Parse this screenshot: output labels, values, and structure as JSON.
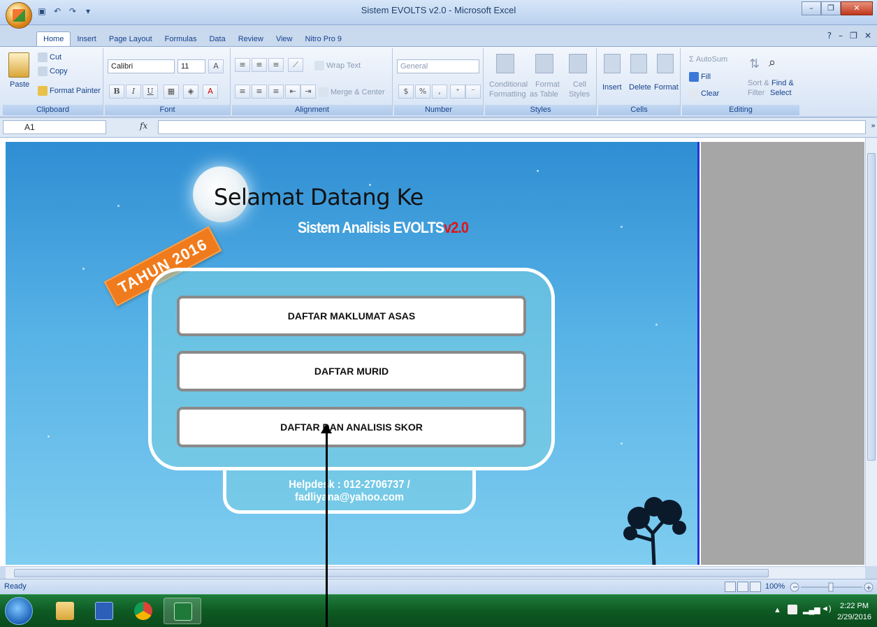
{
  "window": {
    "title": "Sistem EVOLTS v2.0 - Microsoft Excel"
  },
  "tabs": [
    "Home",
    "Insert",
    "Page Layout",
    "Formulas",
    "Data",
    "Review",
    "View",
    "Nitro Pro 9"
  ],
  "ribbon": {
    "clipboard": {
      "label": "Clipboard",
      "paste": "Paste",
      "cut": "Cut",
      "copy": "Copy",
      "format_painter": "Format Painter"
    },
    "font": {
      "label": "Font",
      "name": "Calibri",
      "size": "11"
    },
    "alignment": {
      "label": "Alignment",
      "wrap": "Wrap Text",
      "merge": "Merge & Center"
    },
    "number": {
      "label": "Number",
      "format": "General",
      "currency": "$",
      "percent": "%",
      "comma": ","
    },
    "styles": {
      "label": "Styles",
      "conditional": "Conditional",
      "conditional2": "Formatting",
      "format_table": "Format",
      "format_table2": "as Table",
      "cell_styles": "Cell",
      "cell_styles2": "Styles"
    },
    "cells": {
      "label": "Cells",
      "insert": "Insert",
      "delete": "Delete",
      "format": "Format"
    },
    "editing": {
      "label": "Editing",
      "autosum": "AutoSum",
      "fill": "Fill",
      "clear": "Clear",
      "sort": "Sort &",
      "sort2": "Filter",
      "find": "Find &",
      "find2": "Select"
    }
  },
  "formula_bar": {
    "name_box": "A1",
    "fx": "fx",
    "value": ""
  },
  "dashboard": {
    "welcome": "Selamat Datang Ke",
    "system_name": "Sistem Analisis EVOLTS",
    "version": "v2.0",
    "year_tag": "TAHUN 2016",
    "buttons": [
      "DAFTAR MAKLUMAT ASAS",
      "DAFTAR MURID",
      "DAFTAR DAN ANALISIS SKOR"
    ],
    "helpdesk": "Helpdesk : 012-2706737 / fadliyana@yahoo.com"
  },
  "status": {
    "ready": "Ready",
    "zoom": "100%"
  },
  "taskbar": {
    "time": "2:22 PM",
    "date": "2/29/2016"
  },
  "colors": {
    "sheet_bg": "#3fa2dd",
    "accent_orange": "#f07b1c",
    "version_red": "#e01414"
  }
}
